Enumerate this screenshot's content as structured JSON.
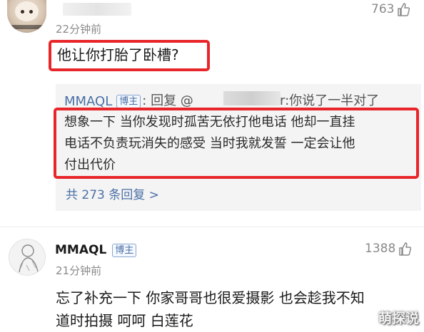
{
  "comment1": {
    "time": "22分钟前",
    "likes": "763",
    "text": "他让你打胎了卧槽?"
  },
  "reply": {
    "author": "MMAQL",
    "badge": "博主",
    "reply_prefix": ": 回复 @",
    "mention_tail": "r:",
    "line1_tail": "你说了一半对了",
    "lines": [
      "想象一下 当你发现时孤苦无依打他电话 他却一直挂",
      "电话不负责玩消失的感受 当时我就发誓 一定会让他",
      "付出代价"
    ],
    "more": "共 273 条回复 >"
  },
  "comment2": {
    "author": "MMAQL",
    "badge": "博主",
    "time": "21分钟前",
    "likes": "1388",
    "lines": [
      "忘了补充一下 你家哥哥也很爱摄影 也会趁我不知",
      "道时拍摄 呵呵 白莲花"
    ]
  },
  "watermark": "萌探说",
  "colors": {
    "highlight": "#e8262a",
    "link": "#4a6fa5",
    "muted": "#8a8a8a",
    "reply_bg": "#f4f4f4"
  },
  "icons": [
    "thumbs-up-icon",
    "user-avatar"
  ]
}
